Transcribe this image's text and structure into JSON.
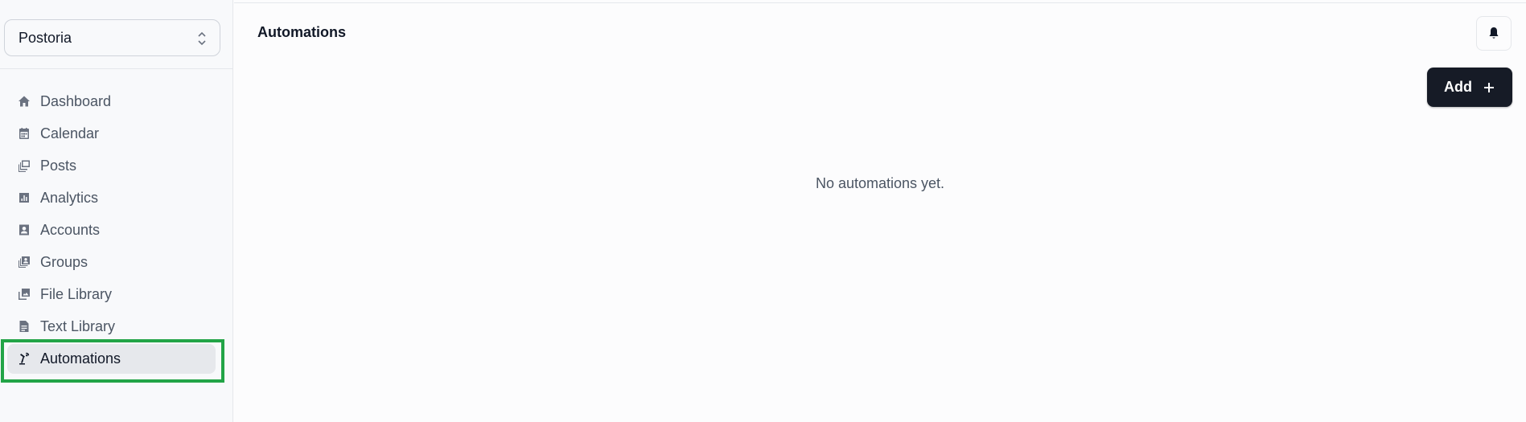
{
  "sidebar": {
    "org_selector": {
      "value": "Postoria"
    },
    "items": [
      {
        "label": "Dashboard",
        "icon": "home-icon"
      },
      {
        "label": "Calendar",
        "icon": "calendar-icon"
      },
      {
        "label": "Posts",
        "icon": "posts-icon"
      },
      {
        "label": "Analytics",
        "icon": "analytics-icon"
      },
      {
        "label": "Accounts",
        "icon": "accounts-icon"
      },
      {
        "label": "Groups",
        "icon": "groups-icon"
      },
      {
        "label": "File Library",
        "icon": "file-library-icon"
      },
      {
        "label": "Text Library",
        "icon": "text-library-icon"
      },
      {
        "label": "Automations",
        "icon": "automations-icon",
        "active": true
      }
    ]
  },
  "header": {
    "title": "Automations"
  },
  "toolbar": {
    "add_label": "Add"
  },
  "main": {
    "empty_message": "No automations yet."
  },
  "colors": {
    "highlight": "#22a447",
    "primary_button": "#161b26"
  }
}
